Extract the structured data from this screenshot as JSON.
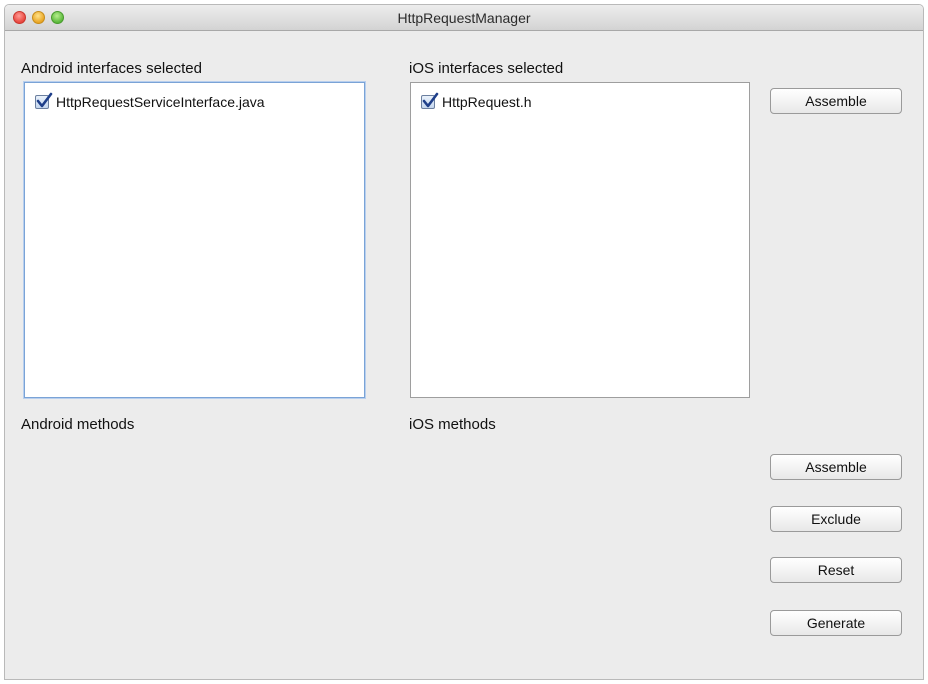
{
  "window": {
    "title": "HttpRequestManager"
  },
  "android": {
    "interfaces_label": "Android interfaces selected",
    "items": [
      {
        "label": "HttpRequestServiceInterface.java",
        "checked": true
      }
    ],
    "methods_label": "Android methods"
  },
  "ios": {
    "interfaces_label": "iOS interfaces selected",
    "items": [
      {
        "label": "HttpRequest.h",
        "checked": true
      }
    ],
    "methods_label": "iOS methods"
  },
  "buttons": {
    "assemble_interfaces": "Assemble",
    "assemble_methods": "Assemble",
    "exclude": "Exclude",
    "reset": "Reset",
    "generate": "Generate"
  },
  "colors": {
    "checkmark": "#1f3f8a",
    "focus_ring": "#7aa3d6"
  }
}
